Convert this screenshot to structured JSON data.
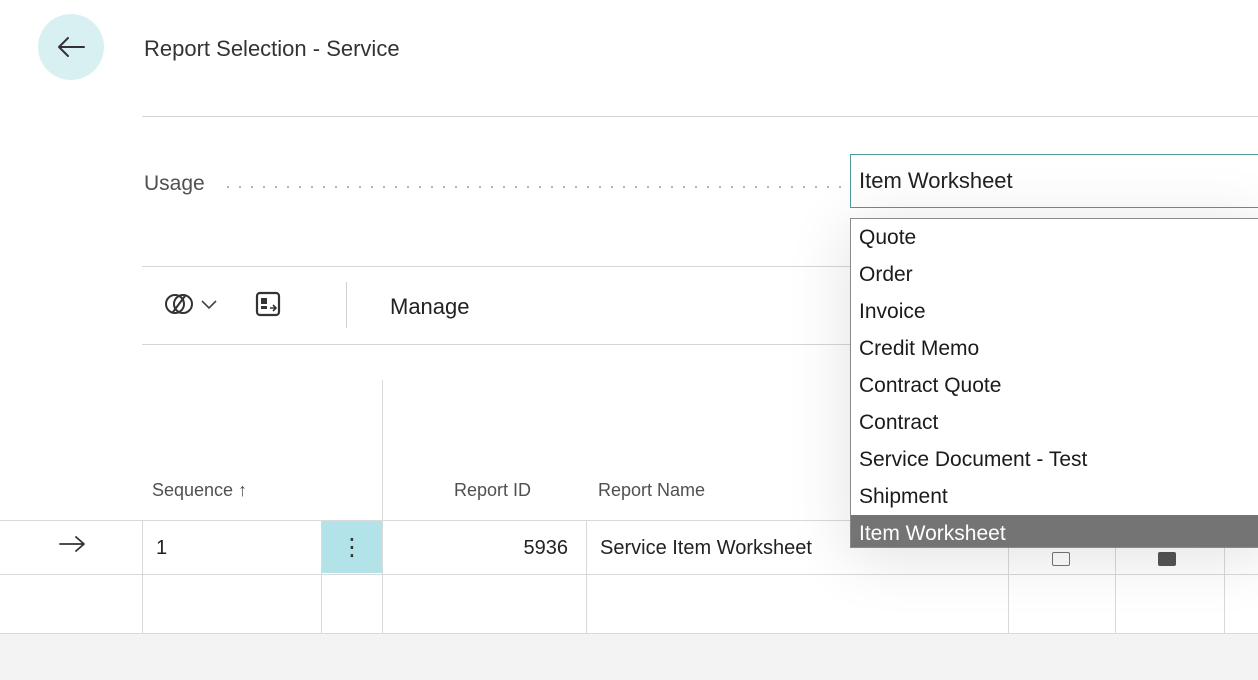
{
  "header": {
    "title": "Report Selection - Service"
  },
  "usage": {
    "label": "Usage",
    "value": "Item Worksheet",
    "options": [
      "Quote",
      "Order",
      "Invoice",
      "Credit Memo",
      "Contract Quote",
      "Contract",
      "Service Document - Test",
      "Shipment",
      "Item Worksheet"
    ],
    "selected_index": 8
  },
  "actionbar": {
    "manage_label": "Manage"
  },
  "grid": {
    "columns": {
      "sequence": "Sequence ↑",
      "report_id": "Report ID",
      "report_name": "Report Name"
    },
    "rows": [
      {
        "sequence": "1",
        "report_id": "5936",
        "report_name": "Service Item Worksheet"
      }
    ]
  },
  "colors": {
    "accent": "#4b9b9b",
    "selection_bg": "#747474",
    "row_menu_bg": "#b2e3e8"
  }
}
